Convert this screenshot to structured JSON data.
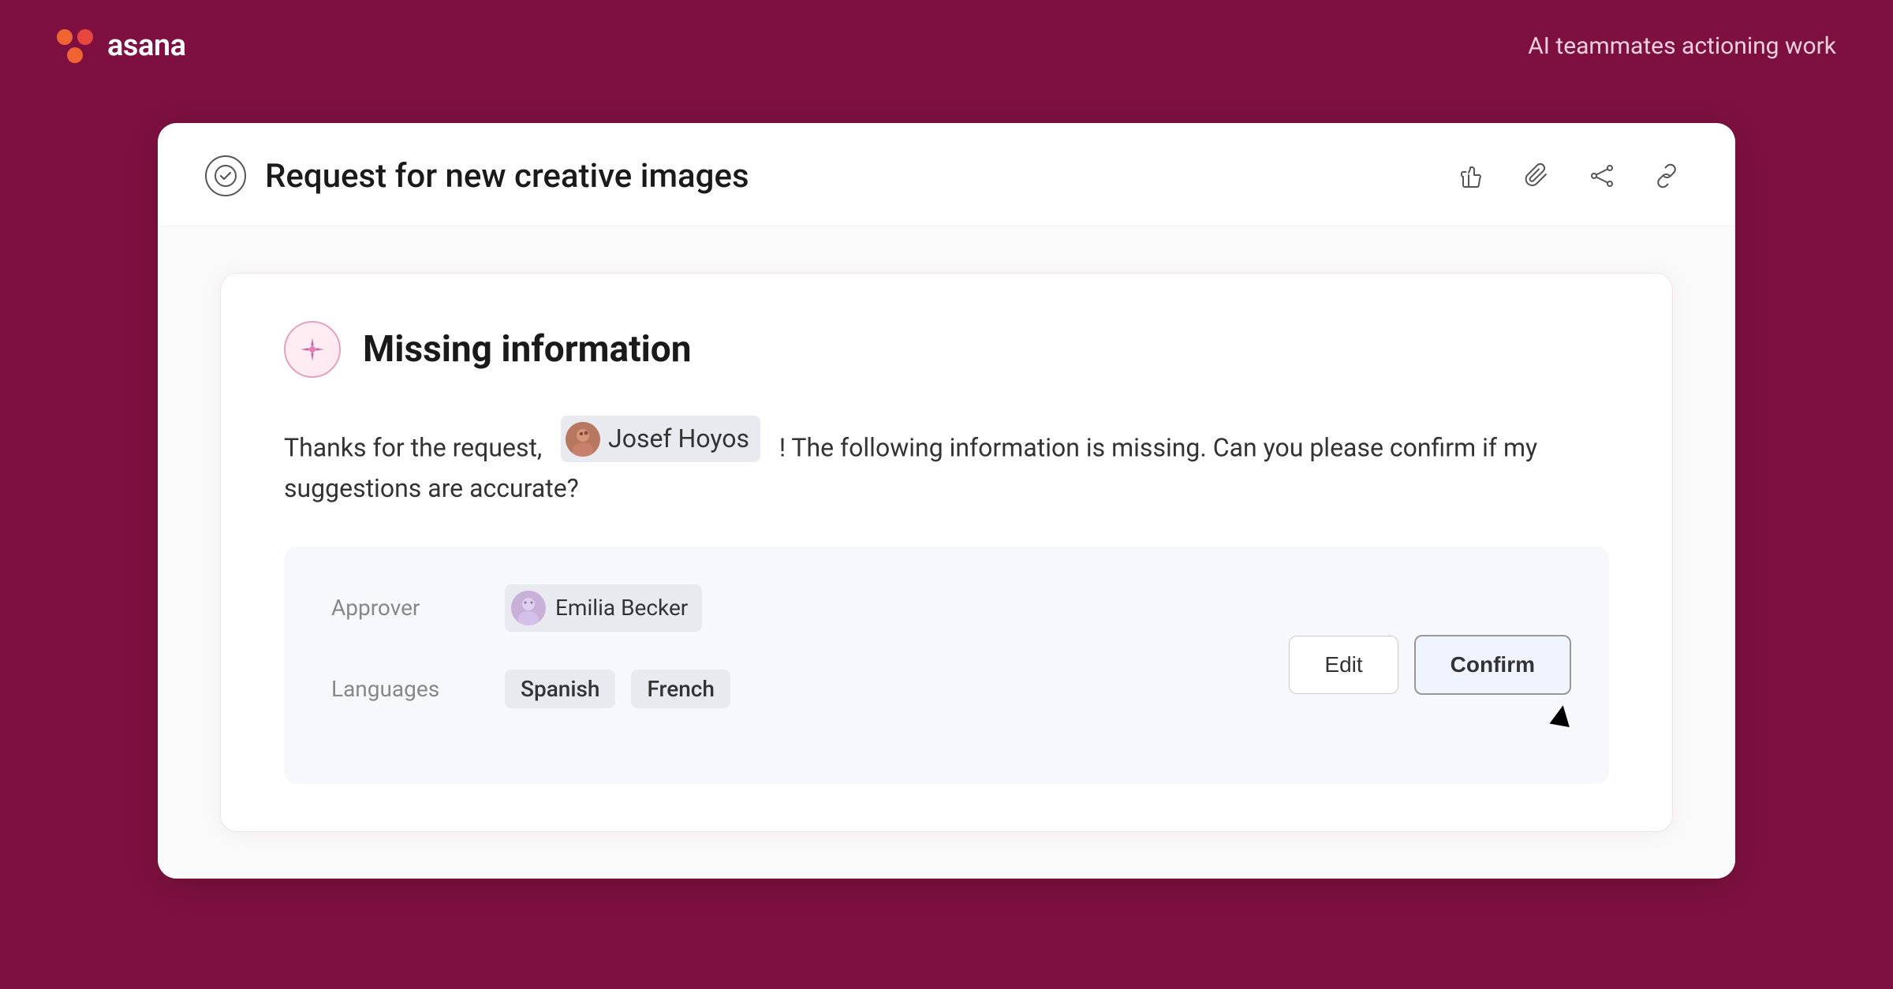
{
  "header": {
    "logo_text": "asana",
    "tagline": "AI teammates actioning work"
  },
  "task": {
    "title": "Request for new creative images",
    "actions": {
      "thumbs_up": "👍",
      "paperclip": "📎",
      "share": "⇄",
      "link": "🔗"
    }
  },
  "missing_info": {
    "heading": "Missing information",
    "message_prefix": "Thanks for the request,",
    "user_name": "Josef Hoyos",
    "message_suffix": "! The following information is missing. Can you please confirm if my suggestions are accurate?",
    "approver_label": "Approver",
    "approver_name": "Emilia Becker",
    "languages_label": "Languages",
    "languages": [
      "Spanish",
      "French"
    ],
    "edit_button": "Edit",
    "confirm_button": "Confirm"
  }
}
